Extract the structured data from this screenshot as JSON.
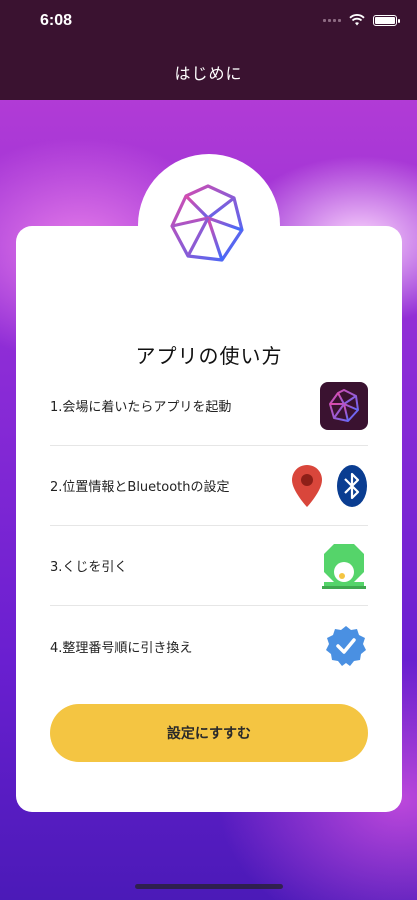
{
  "status": {
    "time": "6:08"
  },
  "nav": {
    "title": "はじめに"
  },
  "card": {
    "title": "アプリの使い方"
  },
  "steps": [
    {
      "label": "1.会場に着いたらアプリを起動",
      "icons": [
        "app-logo-icon"
      ]
    },
    {
      "label": "2.位置情報とBluetoothの設定",
      "icons": [
        "location-pin-icon",
        "bluetooth-icon"
      ]
    },
    {
      "label": "3.くじを引く",
      "icons": [
        "lottery-machine-icon"
      ]
    },
    {
      "label": "4.整理番号順に引き換え",
      "icons": [
        "verified-check-icon"
      ]
    }
  ],
  "button": {
    "label": "設定にすすむ"
  },
  "colors": {
    "navbar": "#3a1230",
    "button": "#f4c542",
    "pin": "#d9463b",
    "bluetooth": "#0a3d91",
    "lottery": "#55d46a",
    "badge": "#4a90e2"
  }
}
